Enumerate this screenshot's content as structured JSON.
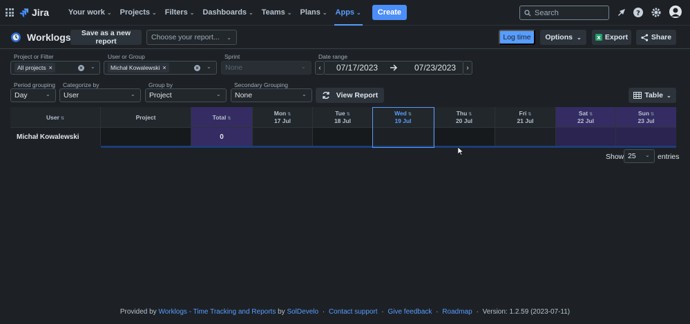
{
  "topnav": {
    "brand": "Jira",
    "items": [
      {
        "label": "Your work"
      },
      {
        "label": "Projects"
      },
      {
        "label": "Filters"
      },
      {
        "label": "Dashboards"
      },
      {
        "label": "Teams"
      },
      {
        "label": "Plans"
      },
      {
        "label": "Apps",
        "active": true
      }
    ],
    "create_label": "Create",
    "search_placeholder": "Search"
  },
  "header": {
    "title": "Worklogs",
    "save_report_label": "Save as a new report",
    "choose_report_placeholder": "Choose your report...",
    "log_time_label": "Log time",
    "options_label": "Options",
    "export_label": "Export",
    "share_label": "Share"
  },
  "filters": {
    "project_label": "Project or Filter",
    "project_value": "All projects",
    "user_label": "User or Group",
    "user_value": "Michał Kowalewski",
    "sprint_label": "Sprint",
    "sprint_value": "None",
    "date_label": "Date range",
    "date_from": "07/17/2023",
    "date_to": "07/23/2023",
    "period_label": "Period grouping",
    "period_value": "Day",
    "categorize_label": "Categorize by",
    "categorize_value": "User",
    "group_label": "Group by",
    "group_value": "Project",
    "secondary_label": "Secondary Grouping",
    "secondary_value": "None",
    "view_report_label": "View Report",
    "table_label": "Table"
  },
  "table": {
    "headers": {
      "user": "User",
      "project": "Project",
      "total": "Total",
      "days": [
        {
          "day": "Mon",
          "date": "17 Jul"
        },
        {
          "day": "Tue",
          "date": "18 Jul"
        },
        {
          "day": "Wed",
          "date": "19 Jul"
        },
        {
          "day": "Thu",
          "date": "20 Jul"
        },
        {
          "day": "Fri",
          "date": "21 Jul"
        },
        {
          "day": "Sat",
          "date": "22 Jul"
        },
        {
          "day": "Sun",
          "date": "23 Jul"
        }
      ]
    },
    "row": {
      "user": "Michał Kowalewski",
      "total": "0"
    }
  },
  "pagination": {
    "show_label": "Show",
    "page_size": "25",
    "entries_label": "entries"
  },
  "footer": {
    "provided_by": "Provided by",
    "app_link": "Worklogs - Time Tracking and Reports",
    "by": "by",
    "vendor_link": "SolDevelo",
    "contact_link": "Contact support",
    "feedback_link": "Give feedback",
    "roadmap_link": "Roadmap",
    "version": "Version: 1.2.59 (2023-07-11)",
    "separator": "·"
  }
}
